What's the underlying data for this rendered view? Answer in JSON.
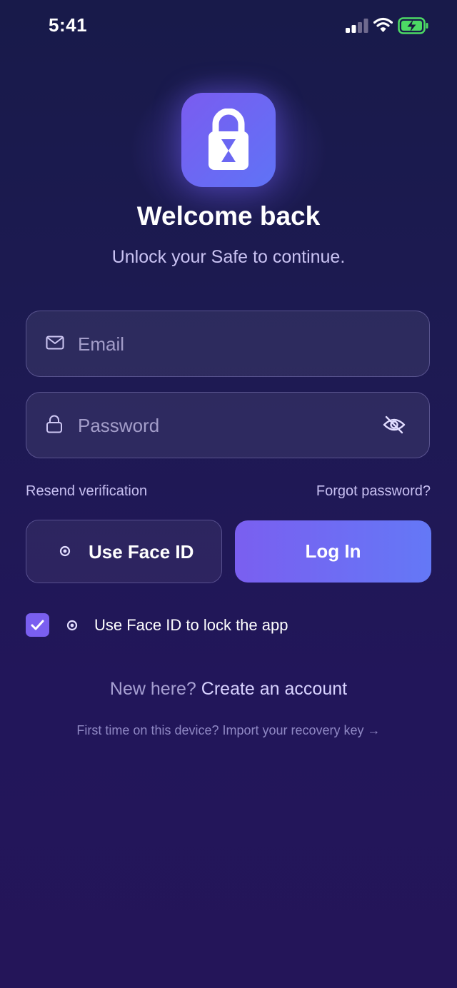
{
  "status_bar": {
    "time": "5:41",
    "icons": [
      "cellular-signal-icon",
      "wifi-icon",
      "battery-charging-icon"
    ],
    "battery_color": "#4cd964"
  },
  "logo": {
    "icon": "padlock-hourglass-icon",
    "gradient": [
      "#7a5cf0",
      "#5f73f6"
    ]
  },
  "header": {
    "title": "Welcome back",
    "subtitle": "Unlock your Safe to continue."
  },
  "form": {
    "email": {
      "icon": "mail-icon",
      "placeholder": "Email",
      "value": ""
    },
    "password": {
      "icon": "lock-icon",
      "placeholder": "Password",
      "value": "",
      "toggle_icon": "eye-off-icon"
    },
    "resend_label": "Resend verification",
    "forgot_label": "Forgot password?"
  },
  "actions": {
    "faceid_label": "Use Face ID",
    "faceid_icon": "face-id-icon",
    "login_label": "Log In",
    "accent": "#7a5ff0"
  },
  "lock_option": {
    "checked": true,
    "icon": "face-id-icon",
    "label": "Use Face ID to lock the app"
  },
  "footer": {
    "signup_prefix": "New here?",
    "signup_link": "Create an account",
    "recovery_link": "First time on this device? Import your recovery key →"
  }
}
